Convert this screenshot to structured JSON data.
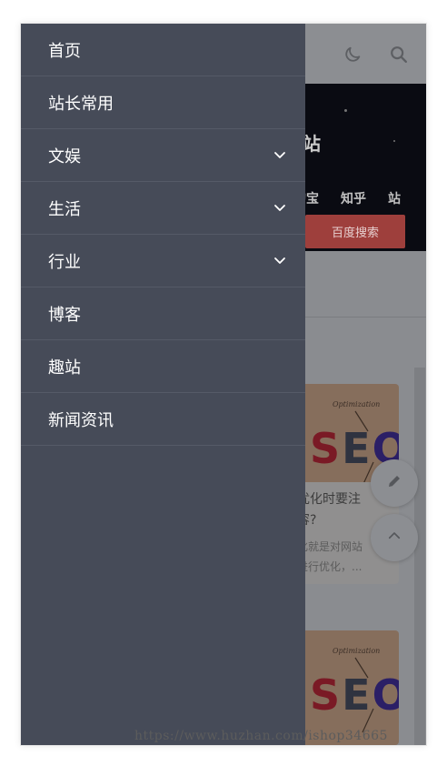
{
  "drawer": {
    "menu": [
      {
        "label": "首页",
        "has_submenu": false
      },
      {
        "label": "站长常用",
        "has_submenu": false
      },
      {
        "label": "文娱",
        "has_submenu": true
      },
      {
        "label": "生活",
        "has_submenu": true
      },
      {
        "label": "行业",
        "has_submenu": true
      },
      {
        "label": "博客",
        "has_submenu": false
      },
      {
        "label": "趣站",
        "has_submenu": false
      },
      {
        "label": "新闻资讯",
        "has_submenu": false
      }
    ]
  },
  "header": {
    "icons": [
      "moon-icon",
      "search-icon"
    ]
  },
  "banner": {
    "title_fragment": "站",
    "tabs": [
      "淘宝",
      "知乎",
      "站"
    ],
    "search_button": "百度搜索"
  },
  "cards": [
    {
      "image_text": "SEO",
      "image_script": "Optimization",
      "title": "优化时要注\n容?",
      "excerpt": "化就是对网站\n进行优化，..."
    },
    {
      "image_text": "SEO",
      "image_script": "Optimization"
    }
  ],
  "fab": {
    "icons": [
      "pencil-icon",
      "chevron-up-icon"
    ]
  },
  "watermark": "https://www.huzhan.com/ishop34665",
  "colors": {
    "drawer_bg": "#464b58",
    "drawer_divider": "#555a67",
    "overlay": "#8a8c90",
    "search_button": "#9e3f3c"
  }
}
